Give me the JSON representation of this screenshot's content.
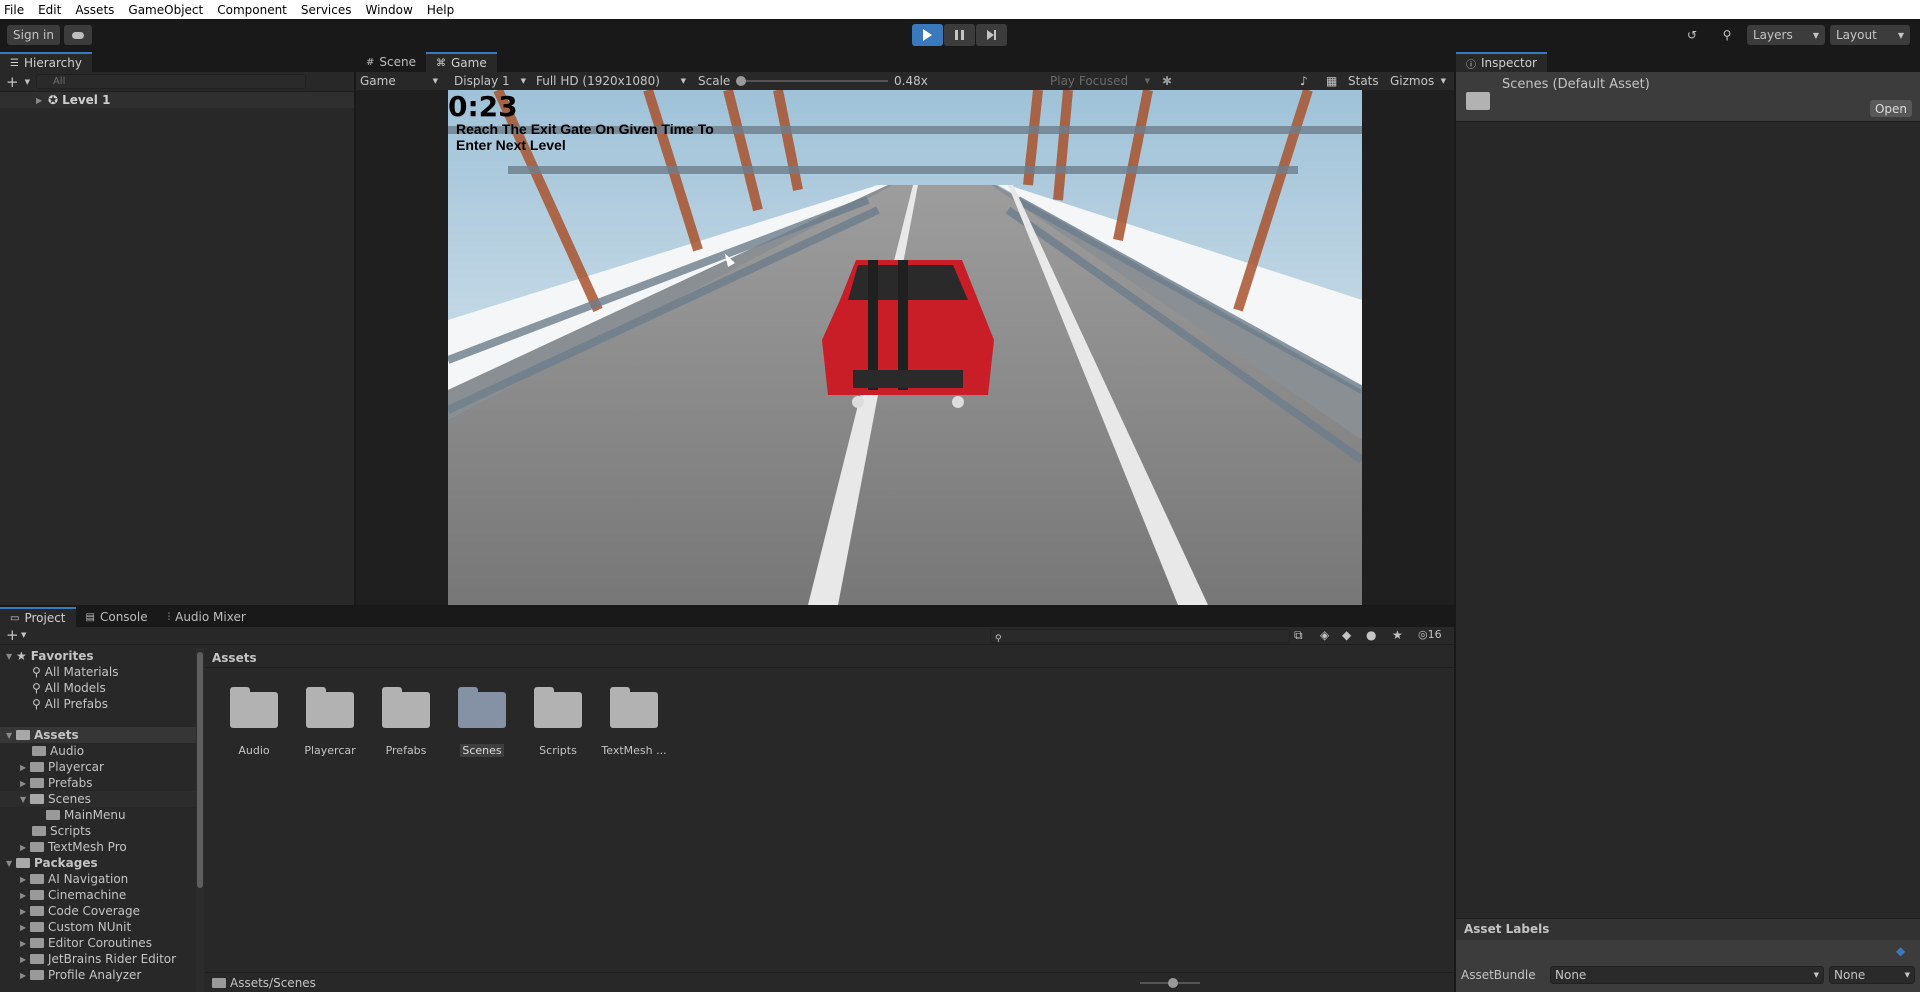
{
  "menu": [
    "File",
    "Edit",
    "Assets",
    "GameObject",
    "Component",
    "Services",
    "Window",
    "Help"
  ],
  "toolbar": {
    "sign_in": "Sign in",
    "layers": "Layers",
    "layout": "Layout"
  },
  "hierarchy": {
    "tab": "Hierarchy",
    "search_placeholder": "All",
    "scene": "Level 1"
  },
  "game": {
    "tabs": [
      "Scene",
      "Game"
    ],
    "mode": "Game",
    "display": "Display 1",
    "resolution": "Full HD (1920x1080)",
    "scale_label": "Scale",
    "scale_value": "0.48x",
    "play_focused": "Play Focused",
    "stats": "Stats",
    "gizmos": "Gizmos",
    "timer": "0:23",
    "hint_line1": "Reach The Exit Gate On Given Time To",
    "hint_line2": "Enter  Next Level"
  },
  "inspector": {
    "tab": "Inspector",
    "title": "Scenes (Default Asset)",
    "open": "Open",
    "asset_labels": "Asset Labels",
    "asset_bundle": "AssetBundle",
    "bundle_value": "None",
    "variant_value": "None"
  },
  "project": {
    "tabs": [
      "Project",
      "Console",
      "Audio Mixer"
    ],
    "hidden_count": "16",
    "breadcrumb": "Assets",
    "path": "Assets/Scenes",
    "favorites": {
      "label": "Favorites",
      "items": [
        "All Materials",
        "All Models",
        "All Prefabs"
      ]
    },
    "assets": {
      "label": "Assets",
      "items": [
        "Audio",
        "Playercar",
        "Prefabs",
        "Scenes",
        "MainMenu",
        "Scripts",
        "TextMesh Pro"
      ]
    },
    "packages": {
      "label": "Packages",
      "items": [
        "AI Navigation",
        "Cinemachine",
        "Code Coverage",
        "Custom NUnit",
        "Editor Coroutines",
        "JetBrains Rider Editor",
        "Profile Analyzer"
      ]
    },
    "grid": [
      "Audio",
      "Playercar",
      "Prefabs",
      "Scenes",
      "Scripts",
      "TextMesh ..."
    ]
  },
  "colors": {
    "accent": "#3a79bb",
    "car": "#d1202a",
    "sky": "#dfe7ee"
  }
}
